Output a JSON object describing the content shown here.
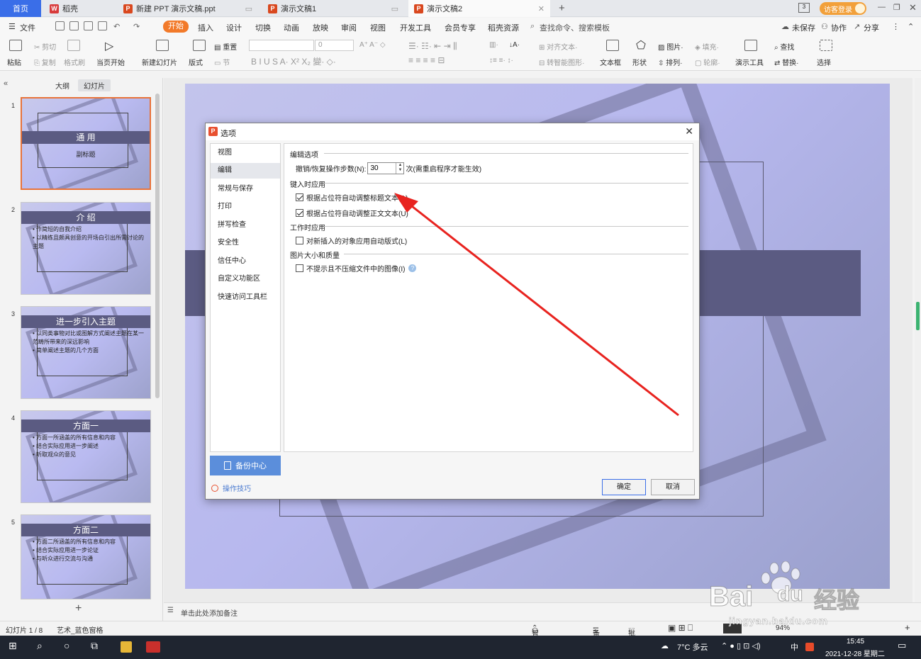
{
  "tabs": {
    "home": "首页",
    "daoke": "稻壳",
    "tab1": "新建 PPT 演示文稿.ppt",
    "tab2": "演示文稿1",
    "tab3": "演示文稿2",
    "login": "访客登录"
  },
  "menu": {
    "file": "文件",
    "start": "开始",
    "items": [
      "插入",
      "设计",
      "切换",
      "动画",
      "放映",
      "审阅",
      "视图",
      "开发工具",
      "会员专享",
      "稻壳资源"
    ],
    "search": "查找命令、搜索模板",
    "unsaved": "未保存",
    "collab": "协作",
    "share": "分享"
  },
  "ribbon": {
    "paste": "粘贴",
    "cut": "剪切",
    "copy": "复制",
    "format_painter": "格式刷",
    "from_current": "当页开始",
    "new_slide": "新建幻灯片",
    "layout": "版式",
    "reset": "重置",
    "section": "节",
    "font_size": "0",
    "align_text": "对齐文本",
    "to_smartart": "转智能图形",
    "textbox": "文本框",
    "shape": "形状",
    "picture": "图片",
    "fill": "填充",
    "arrange": "排列",
    "outline": "轮廓",
    "present_tools": "演示工具",
    "find": "查找",
    "replace": "替换",
    "select": "选择"
  },
  "leftpanel": {
    "tab_outline": "大纲",
    "tab_slides": "幻灯片",
    "thumbs": [
      {
        "num": "1",
        "title": "通 用",
        "sub": "副标题"
      },
      {
        "num": "2",
        "title": "介 绍",
        "bullets": [
          "作简短的自我介绍",
          "以精练且颇具创意的开场白引出所需讨论的主题"
        ]
      },
      {
        "num": "3",
        "title": "进一步引入主题",
        "bullets": [
          "以同类事物对比或图解方式阐述主题在某一范畴所带来的深远影响",
          "简单阐述主题的几个方面"
        ]
      },
      {
        "num": "4",
        "title": "方面一",
        "bullets": [
          "方面一所涵盖的所有信息和内容",
          "结合实际应用进一步阐述",
          "听取观众的意见"
        ]
      },
      {
        "num": "5",
        "title": "方面二",
        "bullets": [
          "方面二所涵盖的所有信息和内容",
          "结合实际应用进一步论证",
          "与听众进行交流与沟通"
        ]
      }
    ]
  },
  "notes": {
    "placeholder": "单击此处添加备注"
  },
  "status": {
    "slide_count": "幻灯片 1 / 8",
    "theme": "艺术_蓝色窗格",
    "beautify": "智能美化",
    "notes": "备注",
    "comment": "批注",
    "zoom": "94%"
  },
  "taskbar": {
    "weather": "7°C 多云",
    "time": "15:45",
    "date": "2021-12-28 星期二",
    "ime": "中"
  },
  "dialog": {
    "title": "选项",
    "nav": [
      "视图",
      "编辑",
      "常规与保存",
      "打印",
      "拼写检查",
      "安全性",
      "信任中心",
      "自定义功能区",
      "快速访问工具栏"
    ],
    "backup": "备份中心",
    "tips": "操作技巧",
    "sections": {
      "edit": "编辑选项",
      "typing": "键入时应用",
      "working": "工作时应用",
      "image": "图片大小和质量"
    },
    "undo_label": "撤销/恢复操作步数(N):",
    "undo_value": "30",
    "undo_suffix": "次(需重启程序才能生效)",
    "opt_title": "根据占位符自动调整标题文本(A)",
    "opt_body": "根据占位符自动调整正文文本(U)",
    "opt_autolayout": "对新插入的对象应用自动版式(L)",
    "opt_nocompress": "不提示且不压缩文件中的图像(I)",
    "ok": "确定",
    "cancel": "取消"
  },
  "watermark": {
    "brand": "Bai",
    "brand2": "du",
    "service": "经验",
    "url": "jingyan.baidu.com"
  },
  "colors": {
    "accent": "#3a6ee8",
    "start": "#f27a2a",
    "annotation": "#e8231f"
  }
}
